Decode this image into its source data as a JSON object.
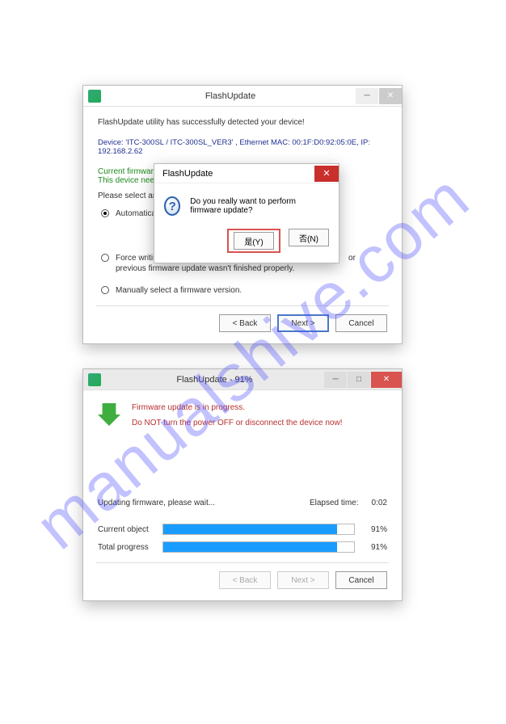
{
  "watermark": "manualshive.com",
  "win1": {
    "title": "FlashUpdate",
    "detected": "FlashUpdate utility has successfully detected your device!",
    "device": "Device: 'ITC-300SL / ITC-300SL_VER3' , Ethernet MAC: 00:1F:D0:92:05:0E, IP: 192.168.2.62",
    "fw1": "Current firmware",
    "fw2": "This device need",
    "prompt": "Please select an",
    "radio1": "Automatically",
    "radio2a": "Force writing",
    "radio2b": " or previous firmware update wasn't finished properly.",
    "radio3": "Manually select a firmware version.",
    "back": "< Back",
    "next": "Next >",
    "cancel": "Cancel"
  },
  "modal": {
    "title": "FlashUpdate",
    "msg": "Do you really want to perform firmware update?",
    "yes": "是(Y)",
    "no": "否(N)"
  },
  "win2": {
    "title": "FlashUpdate - 91%",
    "warn1": "Firmware update is in progress.",
    "warn2": "Do NOT turn the power OFF or disconnect the device now!",
    "updating": "Updating firmware, please wait...",
    "elapsedLabel": "Elapsed time:",
    "elapsed": "0:02",
    "curLabel": "Current object",
    "curPct": "91%",
    "totLabel": "Total progress",
    "totPct": "91%",
    "back": "< Back",
    "next": "Next >",
    "cancel": "Cancel"
  }
}
